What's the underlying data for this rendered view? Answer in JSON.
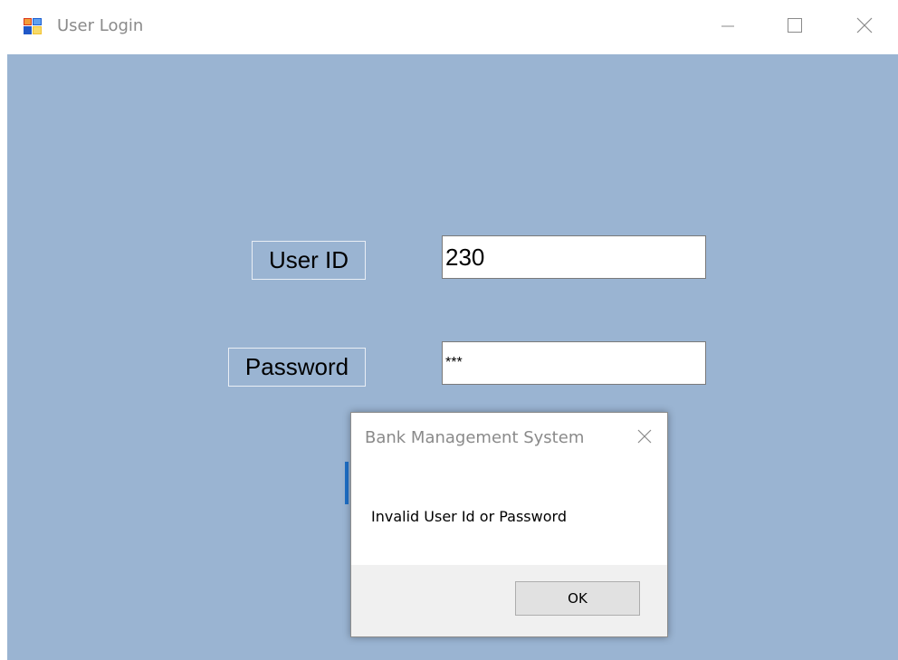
{
  "window": {
    "title": "User Login",
    "icon": "forms-app-icon",
    "controls": {
      "minimize_icon": "minimize-icon",
      "maximize_icon": "maximize-icon",
      "close_icon": "close-icon"
    }
  },
  "form": {
    "background": "#9ab4d2",
    "user_id_label": "User ID",
    "user_id_value": "230",
    "password_label": "Password",
    "password_value": "***"
  },
  "dialog": {
    "title": "Bank Management System",
    "message": "Invalid User Id or Password",
    "ok_label": "OK",
    "close_icon": "close-icon"
  },
  "colors": {
    "accent": "#1e6fc7",
    "client_bg": "#9ab4d2",
    "dialog_footer": "#f0f0f0"
  }
}
